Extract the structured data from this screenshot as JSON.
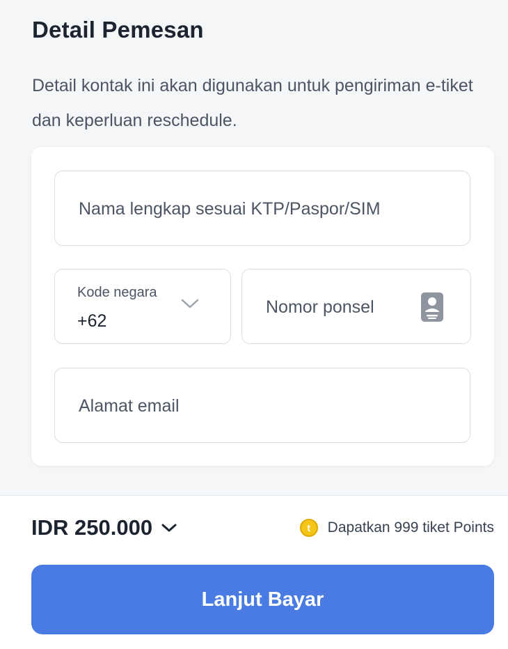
{
  "section": {
    "title": "Detail Pemesan",
    "description": "Detail kontak ini akan digunakan untuk pengiriman e-tiket dan keperluan reschedule."
  },
  "form": {
    "full_name": {
      "placeholder": "Nama lengkap sesuai KTP/Paspor/SIM",
      "value": ""
    },
    "country_code": {
      "label": "Kode negara",
      "value": "+62"
    },
    "phone": {
      "placeholder": "Nomor ponsel",
      "value": "",
      "icon": "contact-book-icon"
    },
    "email": {
      "placeholder": "Alamat email",
      "value": ""
    }
  },
  "footer": {
    "price": "IDR 250.000",
    "points_text": "Dapatkan 999 tiket Points",
    "coin_symbol": "t",
    "cta_label": "Lanjut Bayar"
  },
  "colors": {
    "primary": "#4a7be2",
    "coin": "#f5c518",
    "text": "#1c2430",
    "border": "#d9dde3"
  }
}
